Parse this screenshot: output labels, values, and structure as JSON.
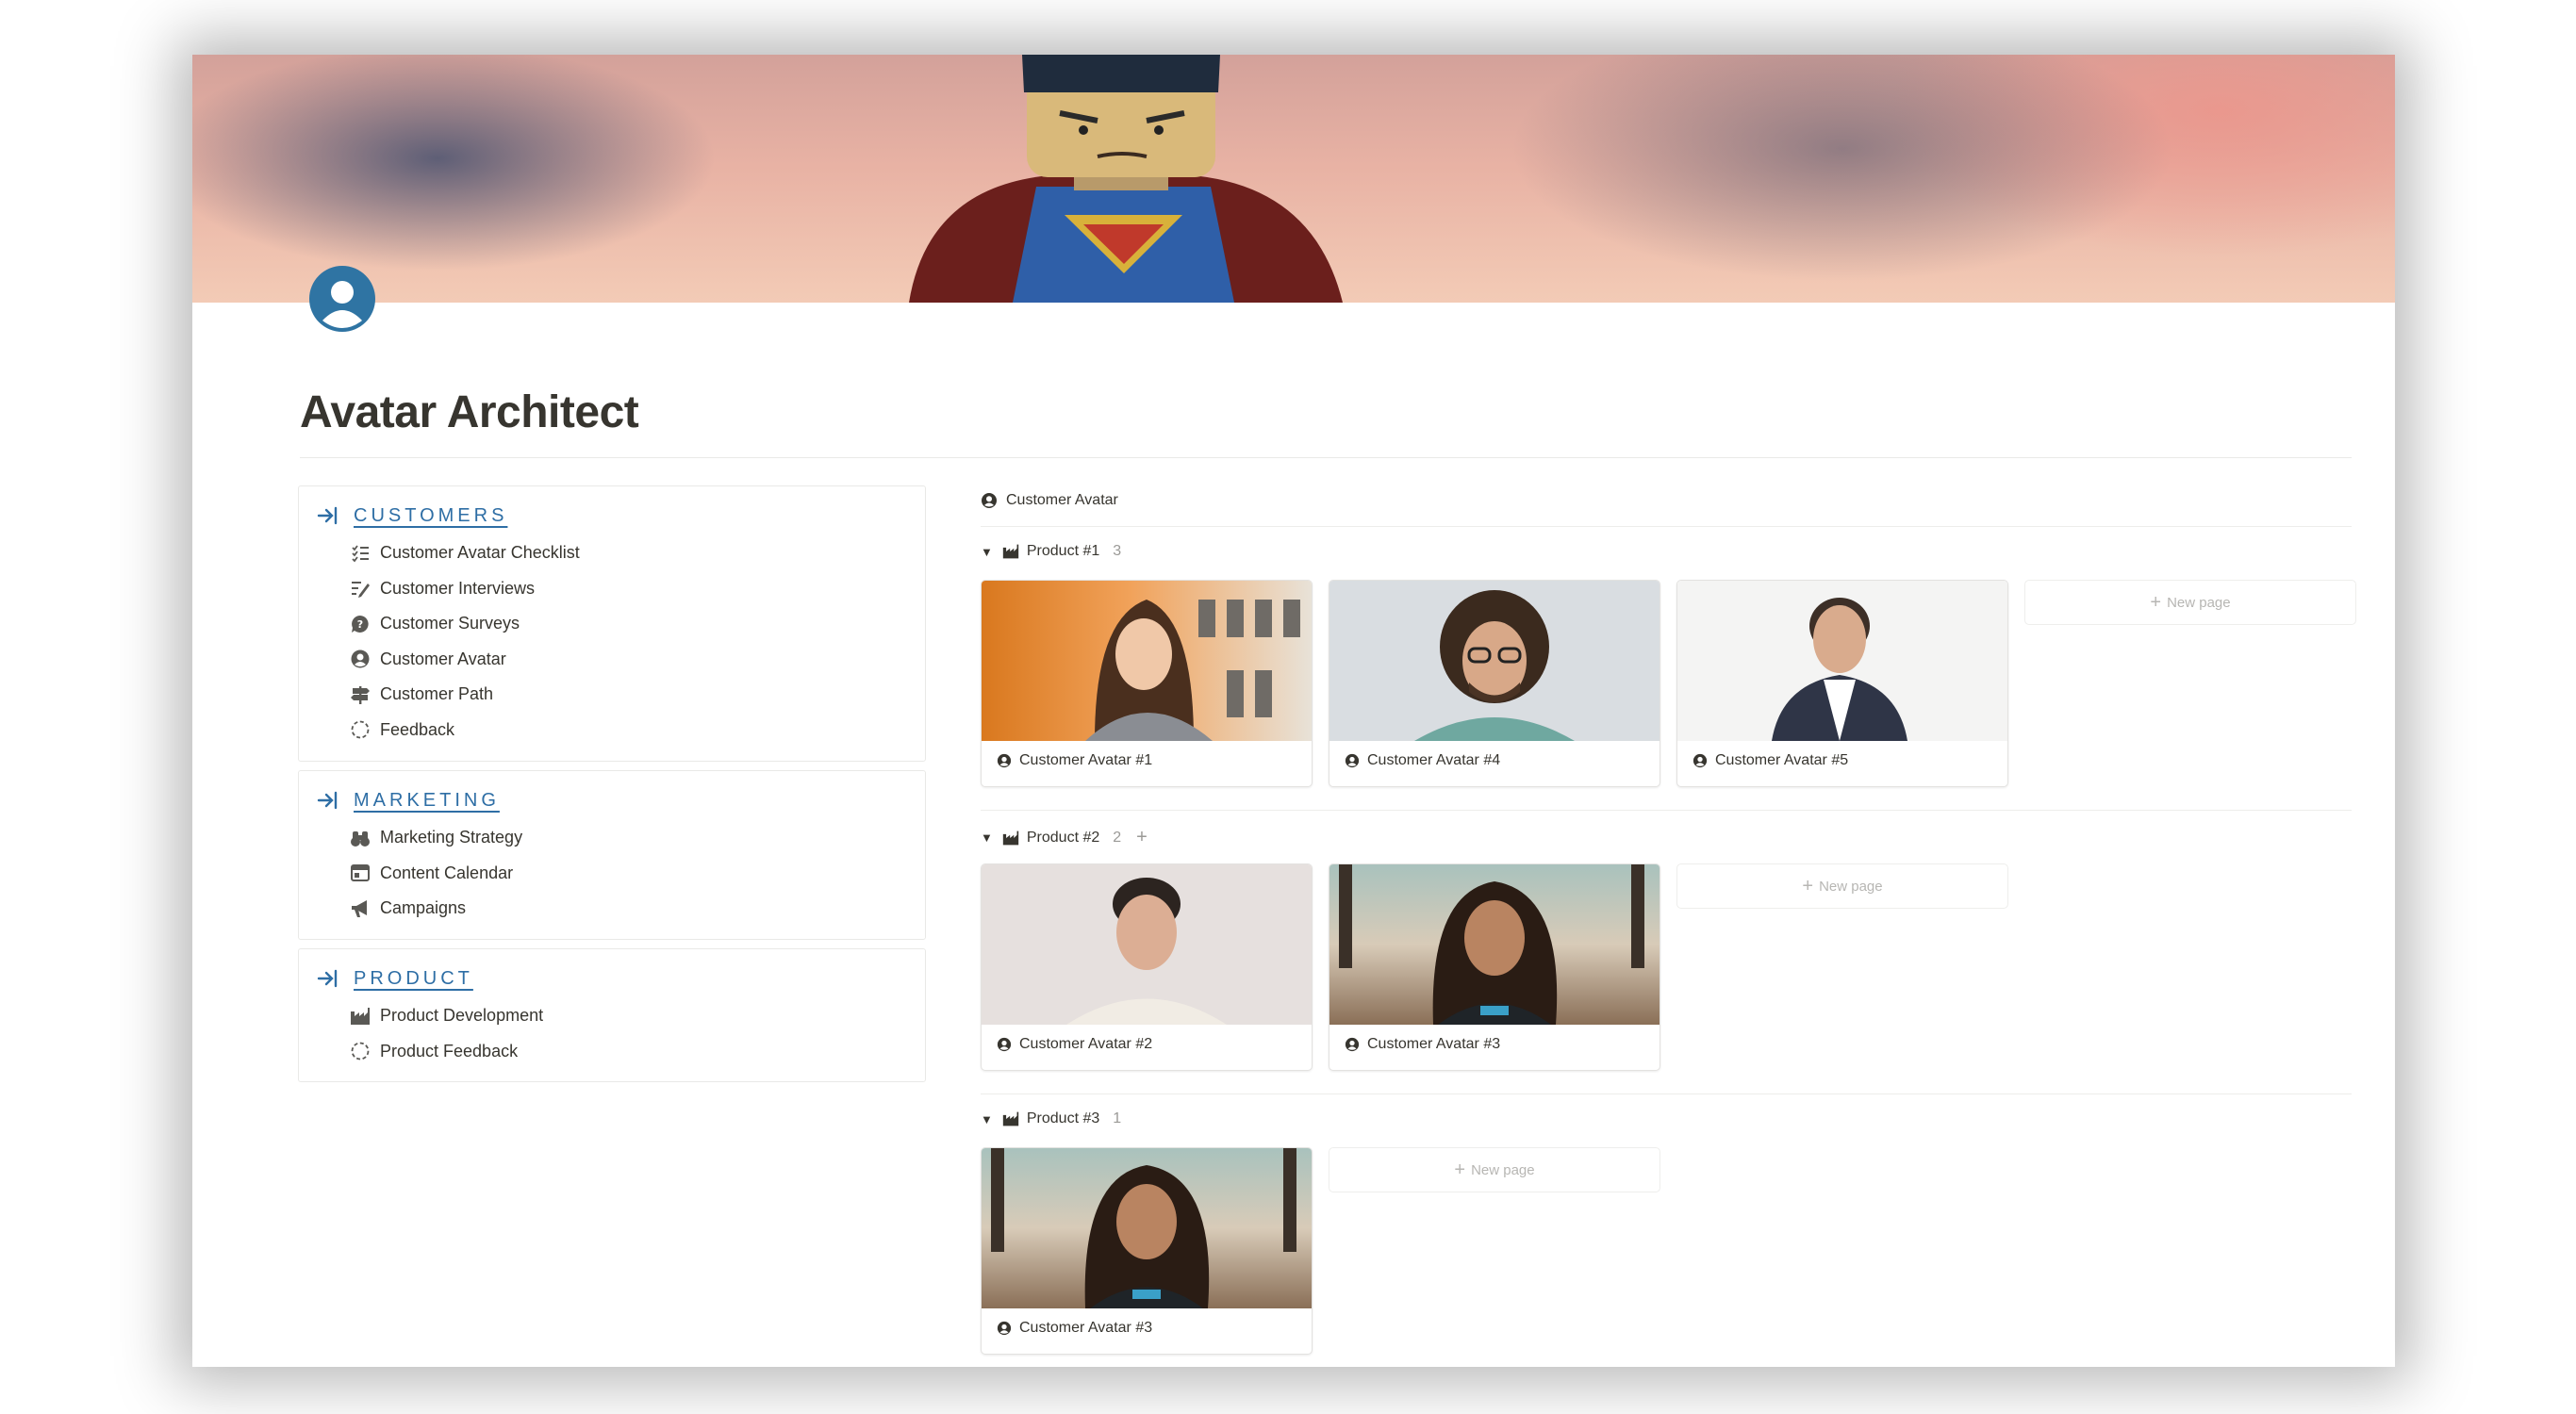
{
  "page": {
    "title": "Avatar Architect"
  },
  "navigation": [
    {
      "heading": "CUSTOMERS",
      "items": [
        {
          "label": "Customer Avatar Checklist",
          "icon": "checklist-icon"
        },
        {
          "label": "Customer Interviews",
          "icon": "edit-lines-icon"
        },
        {
          "label": "Customer Surveys",
          "icon": "question-bubble-icon"
        },
        {
          "label": "Customer Avatar",
          "icon": "user-circle-icon"
        },
        {
          "label": "Customer Path",
          "icon": "signpost-icon"
        },
        {
          "label": "Feedback",
          "icon": "dashed-circle-icon"
        }
      ]
    },
    {
      "heading": "MARKETING",
      "items": [
        {
          "label": "Marketing Strategy",
          "icon": "binoculars-icon"
        },
        {
          "label": "Content Calendar",
          "icon": "calendar-icon"
        },
        {
          "label": "Campaigns",
          "icon": "megaphone-icon"
        }
      ]
    },
    {
      "heading": "PRODUCT",
      "items": [
        {
          "label": "Product Development",
          "icon": "factory-icon"
        },
        {
          "label": "Product Feedback",
          "icon": "dashed-circle-icon"
        }
      ]
    }
  ],
  "database": {
    "title": "Customer Avatar",
    "new_page_label": "New page",
    "groups": [
      {
        "name": "Product #1",
        "count": "3",
        "cards": [
          "Customer Avatar #1",
          "Customer Avatar #4",
          "Customer Avatar #5"
        ]
      },
      {
        "name": "Product #2",
        "count": "2",
        "cards": [
          "Customer Avatar #2",
          "Customer Avatar #3"
        ]
      },
      {
        "name": "Product #3",
        "count": "1",
        "cards": [
          "Customer Avatar #3"
        ]
      }
    ]
  }
}
